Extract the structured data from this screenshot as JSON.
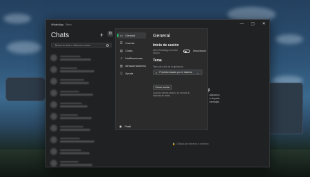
{
  "window": {
    "title": "WhatsApp",
    "beta": "Beta",
    "controls": [
      "—",
      "▢",
      "✕"
    ]
  },
  "chats": {
    "header": "Chats",
    "add_icon": "+",
    "search_placeholder": "Busca un chat o inicia uno nuevo"
  },
  "settings_button_icon": "⚙",
  "nav": {
    "items": [
      {
        "label": "General",
        "icon": "▭"
      },
      {
        "label": "Cuenta",
        "icon": "⚿"
      },
      {
        "label": "Chats",
        "icon": "▤"
      },
      {
        "label": "Notificaciones",
        "icon": "♫"
      },
      {
        "label": "Almacenamiento",
        "icon": "▥"
      },
      {
        "label": "Ayuda",
        "icon": "ⓘ"
      }
    ],
    "profile": {
      "label": "Perfil",
      "icon": "◉"
    }
  },
  "general": {
    "title": "General",
    "login_section": "Inicio de sesión",
    "login_desc": "Abrir WhatsApp al iniciar sesión",
    "toggle_label": "Desactivado",
    "theme_section": "Tema",
    "theme_desc": "Tema de color de la aplicación",
    "theme_value": "Predeterminado por el sistema",
    "theme_icon": "◐",
    "chevron": "⌄",
    "logout_label": "Cerrar sesión",
    "logout_desc": "Cuando cierres sesión, se borrará tu historial de chats."
  },
  "side_texts": [
    "aplicación",
    "ro la parte",
    "mensajes."
  ],
  "side_glyph": "p",
  "encrypt": {
    "icon": "🔒",
    "label": "Cifrado de extremo a extremo"
  },
  "colors": {
    "accent": "#21c063",
    "window_bg": "#202122",
    "panel_bg": "#2b2b2c"
  }
}
